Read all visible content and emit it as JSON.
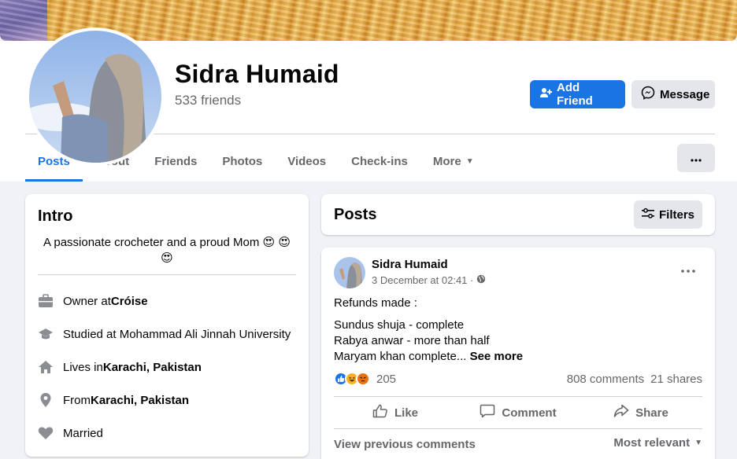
{
  "profile": {
    "name": "Sidra Humaid",
    "friends": "533 friends",
    "add_friend": "Add Friend",
    "message": "Message"
  },
  "tabs": [
    {
      "label": "Posts",
      "active": true
    },
    {
      "label": "About"
    },
    {
      "label": "Friends"
    },
    {
      "label": "Photos"
    },
    {
      "label": "Videos"
    },
    {
      "label": "Check-ins"
    },
    {
      "label": "More"
    }
  ],
  "intro": {
    "title": "Intro",
    "bio": "A passionate crocheter and a proud Mom",
    "bio_emoji": "😍 😍 😍",
    "rows": [
      {
        "icon": "briefcase-icon",
        "prefix": "Owner at ",
        "bold": "Cróise"
      },
      {
        "icon": "graduation-cap-icon",
        "prefix": "Studied at Mohammad Ali Jinnah University",
        "bold": ""
      },
      {
        "icon": "home-icon",
        "prefix": "Lives in ",
        "bold": "Karachi, Pakistan"
      },
      {
        "icon": "location-pin-icon",
        "prefix": "From ",
        "bold": "Karachi, Pakistan"
      },
      {
        "icon": "heart-icon",
        "prefix": "Married",
        "bold": ""
      }
    ]
  },
  "posts_header": {
    "title": "Posts",
    "filters": "Filters"
  },
  "post": {
    "author": "Sidra Humaid",
    "time": "3 December at 02:41 ·",
    "lines": [
      "Refunds made :",
      "Sundus shuja - complete",
      "Rabya anwar - more than half",
      "Maryam khan complete..."
    ],
    "see_more": "See more",
    "reaction_count": "205",
    "comments": "808 comments",
    "shares": "21 shares",
    "like": "Like",
    "comment": "Comment",
    "share": "Share",
    "view_previous": "View previous comments",
    "sort": "Most relevant"
  },
  "colors": {
    "accent": "#1b74e4",
    "background": "#f0f2f5",
    "secondary_text": "#65676b"
  }
}
